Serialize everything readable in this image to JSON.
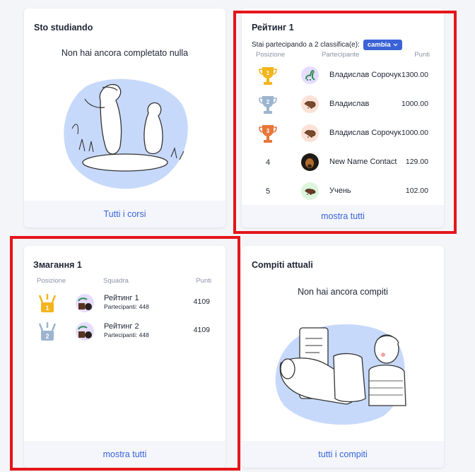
{
  "studying": {
    "title": "Sto studiando",
    "empty_message": "Non hai ancora completato nulla",
    "footer_link": "Tutti i corsi"
  },
  "rating": {
    "title": "Рейтинг 1",
    "participating_text": "Stai partecipando a 2 classifica(e):",
    "change_label": "cambia",
    "columns": {
      "position": "Posizione",
      "participant": "Partecipante",
      "points": "Punti"
    },
    "rows": [
      {
        "position": "1",
        "name": "Владислав Сорочук",
        "points": "1300.00",
        "avatar": "dinosaur-icon"
      },
      {
        "position": "2",
        "name": "Владислав",
        "points": "1000.00",
        "avatar": "bison-icon"
      },
      {
        "position": "3",
        "name": "Владислав Сорочук",
        "points": "1000.00",
        "avatar": "bison-icon"
      },
      {
        "position": "4",
        "name": "New Name Contact",
        "points": "129.00",
        "avatar": "dog-photo"
      },
      {
        "position": "5",
        "name": "Учень",
        "points": "102.00",
        "avatar": "boar-icon"
      }
    ],
    "footer_link": "mostra tutti"
  },
  "contest": {
    "title": "Змагання 1",
    "columns": {
      "position": "Posizione",
      "team": "Squadra",
      "points": "Punti"
    },
    "rows": [
      {
        "position": "1",
        "name": "Рейтинг 1",
        "participants": "Partecipanti: 448",
        "points": "4109"
      },
      {
        "position": "2",
        "name": "Рейтинг 2",
        "participants": "Partecipanti: 448",
        "points": "4109"
      }
    ],
    "footer_link": "mostra tutti"
  },
  "tasks": {
    "title": "Compiti attuali",
    "empty_message": "Non hai ancora compiti",
    "footer_link": "tutti i compiti"
  },
  "colors": {
    "accent": "#3a63d6",
    "highlight": "#e4161b",
    "gold": "#f3b51b",
    "silver": "#9cb4cf",
    "bronze": "#e8763a"
  }
}
